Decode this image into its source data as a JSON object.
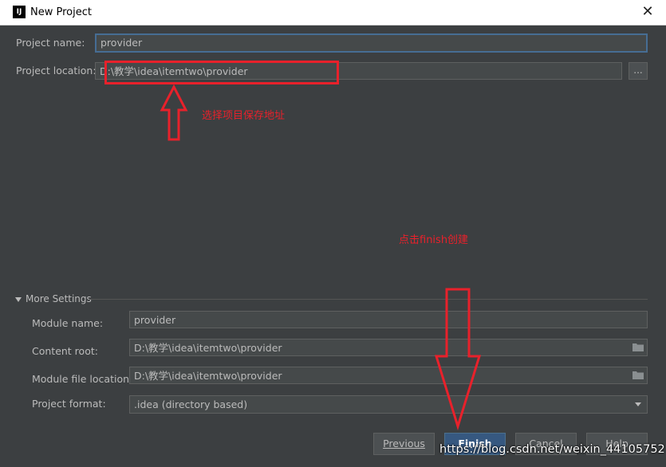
{
  "window": {
    "title": "New Project",
    "app_icon_text": "IJ",
    "close_glyph": "✕"
  },
  "project": {
    "name_label": "Project name:",
    "name_value": "provider",
    "location_label": "Project location:",
    "location_value": "D:\\教学\\idea\\itemtwo\\provider",
    "browse_label": "..."
  },
  "annotations": {
    "location_note": "选择项目保存地址",
    "finish_note": "点击finish创建"
  },
  "more_settings": {
    "header": "More Settings",
    "module_name_label": "Module name:",
    "module_name_value": "provider",
    "content_root_label": "Content root:",
    "content_root_value": "D:\\教学\\idea\\itemtwo\\provider",
    "module_file_label": "Module file location:",
    "module_file_value": "D:\\教学\\idea\\itemtwo\\provider",
    "format_label": "Project format:",
    "format_value": ".idea (directory based)"
  },
  "buttons": {
    "previous": "Previous",
    "finish": "Finish",
    "cancel": "Cancel",
    "help": "Help"
  },
  "watermark": "https://blog.csdn.net/weixin_44105752",
  "colors": {
    "accent": "#365880",
    "annotation": "#e8212b",
    "background": "#3c3f41"
  }
}
